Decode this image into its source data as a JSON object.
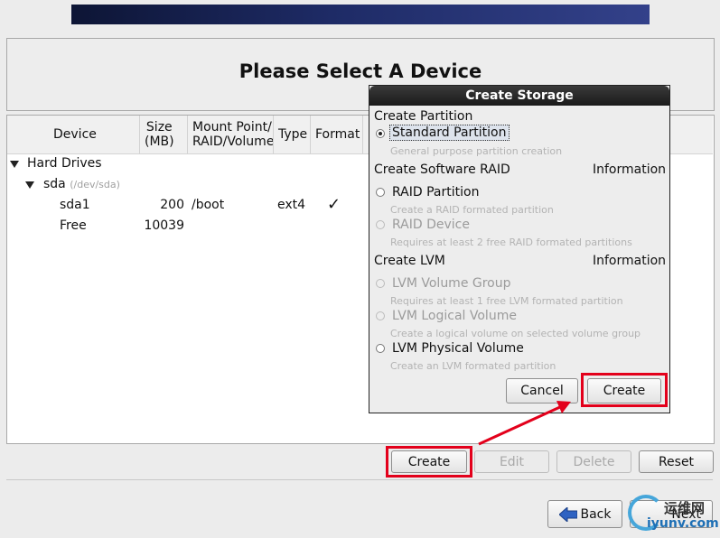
{
  "page": {
    "title": "Please Select A Device"
  },
  "table": {
    "headers": [
      "Device",
      "Size\n(MB)",
      "Mount Point/\nRAID/Volume",
      "Type",
      "Format"
    ],
    "header_lines": {
      "device": "Device",
      "size_1": "Size",
      "size_2": "(MB)",
      "mount_1": "Mount Point/",
      "mount_2": "RAID/Volume",
      "type": "Type",
      "format": "Format"
    },
    "tree": {
      "hard_drives": "Hard Drives",
      "sda": "sda",
      "sda_path": "(/dev/sda)",
      "rows": [
        {
          "device": "sda1",
          "size": "200",
          "mount": "/boot",
          "type": "ext4",
          "format": "✓"
        },
        {
          "device": "Free",
          "size": "10039",
          "mount": "",
          "type": "",
          "format": ""
        }
      ]
    }
  },
  "actions": {
    "create": "Create",
    "edit": "Edit",
    "delete": "Delete",
    "reset": "Reset"
  },
  "nav": {
    "back": "Back",
    "next": "Next"
  },
  "watermark": {
    "line1": "运维网",
    "line2": "iyunv.com"
  },
  "dialog": {
    "title": "Create Storage",
    "sections": {
      "partition": "Create Partition",
      "raid": "Create Software RAID",
      "lvm": "Create LVM",
      "info": "Information"
    },
    "options": {
      "standard": {
        "label": "Standard Partition",
        "desc": "General purpose partition creation"
      },
      "raid_partition": {
        "label": "RAID Partition",
        "desc": "Create a RAID formated partition"
      },
      "raid_device": {
        "label": "RAID Device",
        "desc": "Requires at least 2 free RAID formated partitions"
      },
      "lvm_vg": {
        "label": "LVM Volume Group",
        "desc": "Requires at least 1 free LVM formated partition"
      },
      "lvm_lv": {
        "label": "LVM Logical Volume",
        "desc": "Create a logical volume on selected volume group"
      },
      "lvm_pv": {
        "label": "LVM Physical Volume",
        "desc": "Create an LVM formated partition"
      }
    },
    "buttons": {
      "cancel": "Cancel",
      "create": "Create"
    }
  },
  "colors": {
    "highlight": "#e3001b",
    "banner": "#1e2b66",
    "dialog_title": "#222222"
  }
}
